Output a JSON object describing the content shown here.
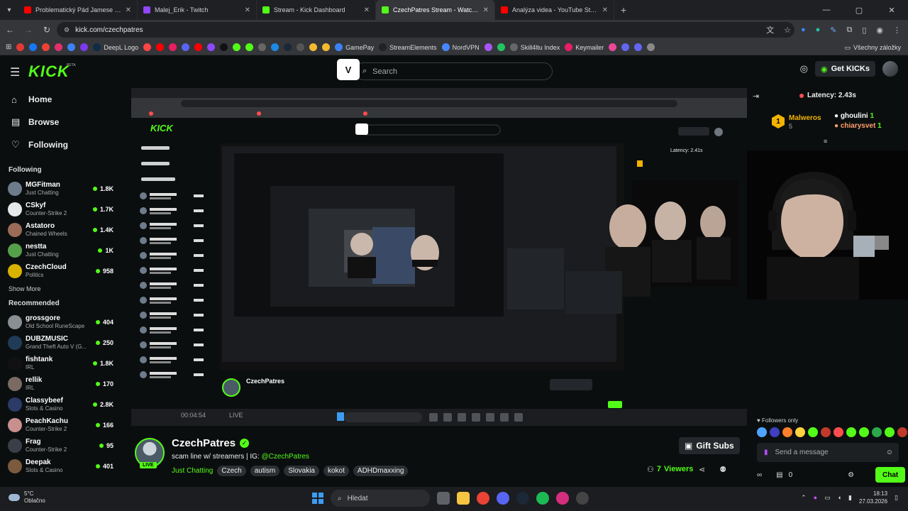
{
  "browser": {
    "tabs": [
      {
        "label": "Problematický Pád Jamese Franca",
        "color": "#ff0000",
        "active": false
      },
      {
        "label": "Malej_Erik - Twitch",
        "color": "#9146ff",
        "active": false
      },
      {
        "label": "Stream - Kick Dashboard",
        "color": "#53fc18",
        "active": false
      },
      {
        "label": "CzechPatres Stream - Watch Live",
        "color": "#53fc18",
        "active": true
      },
      {
        "label": "Analýza videa - YouTube Studio",
        "color": "#ff0000",
        "active": false
      }
    ],
    "url": "kick.com/czechpatres",
    "bookmarks": [
      {
        "label": "",
        "color": "#e53935"
      },
      {
        "label": "",
        "color": "#1877f2"
      },
      {
        "label": "",
        "color": "#ea4335"
      },
      {
        "label": "",
        "color": "#e1306c"
      },
      {
        "label": "",
        "color": "#3b82f6"
      },
      {
        "label": "",
        "color": "#7c3aed"
      },
      {
        "label": "DeepL Logo",
        "color": "#0f2b46"
      },
      {
        "label": "",
        "color": "#ff4444"
      },
      {
        "label": "",
        "color": "#ff0000"
      },
      {
        "label": "",
        "color": "#e91e63"
      },
      {
        "label": "",
        "color": "#5865f2"
      },
      {
        "label": "",
        "color": "#ff0000"
      },
      {
        "label": "",
        "color": "#9146ff"
      },
      {
        "label": "",
        "color": "#111111"
      },
      {
        "label": "",
        "color": "#53fc18"
      },
      {
        "label": "",
        "color": "#53fc18"
      },
      {
        "label": "",
        "color": "#666666"
      },
      {
        "label": "",
        "color": "#1e88e5"
      },
      {
        "label": "",
        "color": "#1b2838"
      },
      {
        "label": "",
        "color": "#555555"
      },
      {
        "label": "",
        "color": "#f3ba2f"
      },
      {
        "label": "",
        "color": "#f3ba2f"
      },
      {
        "label": "GamePay",
        "color": "#3b82f6"
      },
      {
        "label": "StreamElements",
        "color": "#222222"
      },
      {
        "label": "NordVPN",
        "color": "#4687ff"
      },
      {
        "label": "",
        "color": "#a855f7"
      },
      {
        "label": "",
        "color": "#22c55e"
      },
      {
        "label": "Skill4ltu Index",
        "color": "#666666"
      },
      {
        "label": "Keymailer",
        "color": "#e91e63"
      },
      {
        "label": "",
        "color": "#ec4899"
      },
      {
        "label": "",
        "color": "#6366f1"
      },
      {
        "label": "",
        "color": "#6366f1"
      },
      {
        "label": "",
        "color": "#888888"
      }
    ],
    "all_bookmarks": "Všechny záložky"
  },
  "header": {
    "logo": "KICK",
    "logo_beta": "BETA",
    "search_placeholder": "Search",
    "get_kicks": "Get KICKs"
  },
  "sidebar": {
    "nav": [
      {
        "label": "Home",
        "icon": "home-icon"
      },
      {
        "label": "Browse",
        "icon": "browse-icon"
      },
      {
        "label": "Following",
        "icon": "heart-icon"
      }
    ],
    "following_title": "Following",
    "following": [
      {
        "name": "MGFitman",
        "category": "Just Chatting",
        "viewers": "1.8K",
        "color": "#6d7b8a"
      },
      {
        "name": "CSkyf",
        "category": "Counter-Strike 2",
        "viewers": "1.7K",
        "color": "#e5e7eb"
      },
      {
        "name": "Astatoro",
        "category": "Chained Wheels",
        "viewers": "1.4K",
        "color": "#9b6b58"
      },
      {
        "name": "nestta",
        "category": "Just Chatting",
        "viewers": "1K",
        "color": "#55a04a"
      },
      {
        "name": "CzechCloud",
        "category": "Politics",
        "viewers": "958",
        "color": "#d9b200"
      }
    ],
    "show_more": "Show More",
    "recommended_title": "Recommended",
    "recommended": [
      {
        "name": "grossgore",
        "category": "Old School RuneScape",
        "viewers": "404",
        "color": "#8a8f94"
      },
      {
        "name": "DUBZMUSIC",
        "category": "Grand Theft Auto V (G...",
        "viewers": "250",
        "color": "#1f3b57"
      },
      {
        "name": "fishtank",
        "category": "IRL",
        "viewers": "1.8K",
        "color": "#111111"
      },
      {
        "name": "rellik",
        "category": "IRL",
        "viewers": "170",
        "color": "#7a6a62"
      },
      {
        "name": "Classybeef",
        "category": "Slots & Casino",
        "viewers": "2.8K",
        "color": "#2b3a66"
      },
      {
        "name": "PeachKachu",
        "category": "Counter-Strike 2",
        "viewers": "166",
        "color": "#c98f8f"
      },
      {
        "name": "Frag",
        "category": "Counter-Strike 2",
        "viewers": "95",
        "color": "#3a3f47"
      },
      {
        "name": "Deepak",
        "category": "Slots & Casino",
        "viewers": "401",
        "color": "#7b5a3d"
      }
    ]
  },
  "player": {
    "nested_latency": "Latency: 2.41s",
    "nested_time": "00:04:54",
    "nested_live": "LIVE"
  },
  "channel": {
    "name": "CzechPatres",
    "live": "LIVE",
    "title_prefix": "scam line w/ streamers | IG: ",
    "title_handle": "@CzechPatres",
    "category": "Just Chatting",
    "tags": [
      "Czech",
      "autism",
      "Slovakia",
      "kokot",
      "ADHDmaxxing"
    ],
    "gift_subs": "Gift Subs",
    "viewers_count": "7",
    "viewers_label": "Viewers"
  },
  "chat": {
    "latency": "Latency: 2.43s",
    "top": [
      {
        "rank": "1",
        "name": "Malweros",
        "count": "5",
        "color": "#f2b200"
      },
      {
        "rank": "",
        "name": "ghoulini",
        "count": "1",
        "color": "#ffffff"
      },
      {
        "rank": "",
        "name": "chiarysvet",
        "count": "1",
        "color": "#ff9e6d"
      }
    ],
    "followers_only": "Followers only",
    "placeholder": "Send a message",
    "kicks_count": "0",
    "chat_button": "Chat",
    "emote_colors": [
      "#4fa3ff",
      "#3f3fbf",
      "#ff7f2a",
      "#ffd23f",
      "#53fc18",
      "#c0392b",
      "#ff4d4d",
      "#53fc18",
      "#53fc18",
      "#2aa84a",
      "#53fc18",
      "#c0392b"
    ]
  },
  "taskbar": {
    "temp": "5°C",
    "weather": "Oblačno",
    "search": "Hledat",
    "time": "18:13",
    "date": "27.03.2026"
  }
}
